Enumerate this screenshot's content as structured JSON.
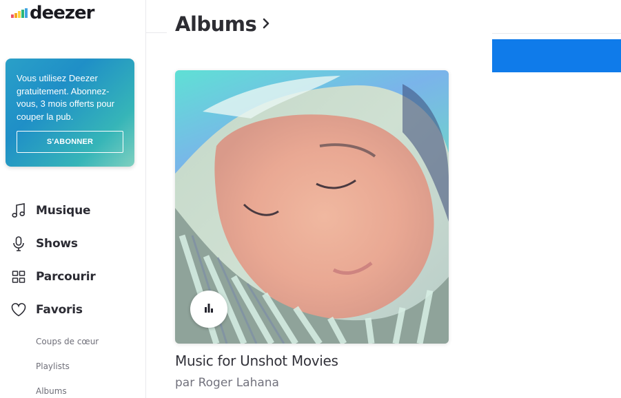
{
  "brand": {
    "name": "deezer",
    "eq_colors": [
      "#ef5466",
      "#f5a623",
      "#ffd33f",
      "#29b67a",
      "#3fa3e2"
    ]
  },
  "promo": {
    "text": "Vous utilisez Deezer gratuitement. Abonnez-vous, 3 mois offerts pour couper la pub.",
    "button_label": "S'ABONNER"
  },
  "nav": {
    "items": [
      {
        "label": "Musique",
        "icon": "music-note-icon"
      },
      {
        "label": "Shows",
        "icon": "microphone-icon"
      },
      {
        "label": "Parcourir",
        "icon": "grid-icon"
      },
      {
        "label": "Favoris",
        "icon": "heart-icon"
      }
    ],
    "subitems": [
      {
        "label": "Coups de cœur"
      },
      {
        "label": "Playlists"
      },
      {
        "label": "Albums"
      }
    ]
  },
  "main": {
    "title": "Albums",
    "album": {
      "title": "Music for Unshot Movies",
      "by_prefix": "par",
      "artist": "Roger Lahana"
    }
  },
  "colors": {
    "accent_blue": "#0f7bea",
    "promo_gradient_start": "#1f8fc7",
    "promo_gradient_end": "#7fd0c0"
  }
}
